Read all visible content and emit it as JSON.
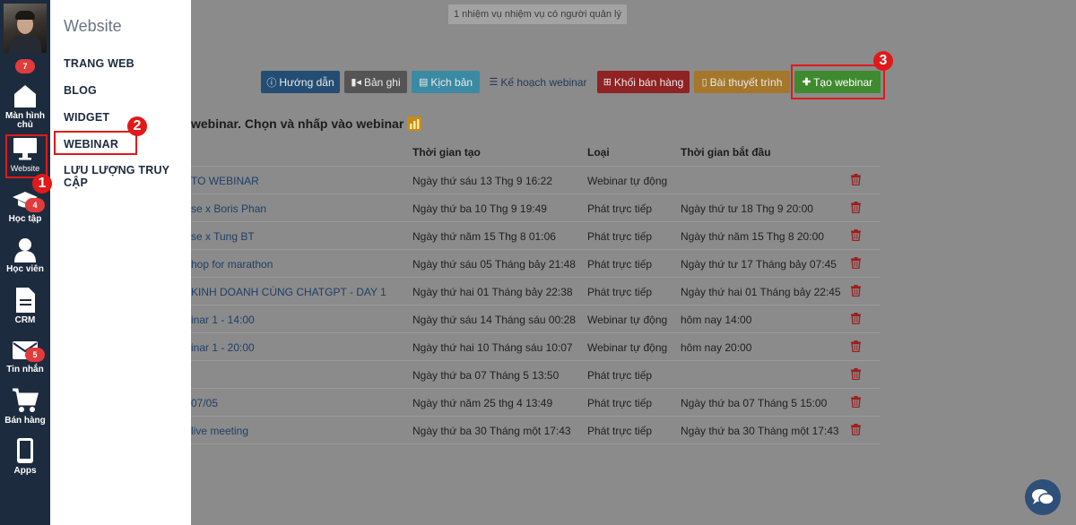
{
  "sidebar": {
    "avatar_badge": "7",
    "items": [
      {
        "label": "Màn hình chủ",
        "icon": "home-icon"
      },
      {
        "label": "Website",
        "icon": "monitor-icon"
      },
      {
        "label": "Học tập",
        "icon": "graduation-cap-icon",
        "badge": "4"
      },
      {
        "label": "Học viên",
        "icon": "user-icon"
      },
      {
        "label": "CRM",
        "icon": "document-icon"
      },
      {
        "label": "Tin nhắn",
        "icon": "mail-icon",
        "badge": "5"
      },
      {
        "label": "Bán hàng",
        "icon": "cart-icon"
      },
      {
        "label": "Apps",
        "icon": "phone-icon"
      }
    ]
  },
  "flyout": {
    "title": "Website",
    "items": [
      "TRANG WEB",
      "BLOG",
      "WIDGET",
      "WEBINAR",
      "LƯU LƯỢNG TRUY CẬP"
    ]
  },
  "notice": "1 nhiệm vụ nhiệm vụ có người quản lý",
  "toolbar": {
    "guide": "Hướng dẫn",
    "recording": "Bản ghi",
    "script": "Kịch bản",
    "plan": "Kế hoạch webinar",
    "sales_block": "Khối bán hàng",
    "presentation": "Bài thuyết trình",
    "create": "Tạo webinar"
  },
  "section_title": "webinar. Chọn và nhấp vào webinar",
  "table": {
    "headers": {
      "created": "Thời gian tạo",
      "type": "Loại",
      "start": "Thời gian bắt đầu"
    },
    "rows": [
      {
        "name": "TO WEBINAR",
        "created": "Ngày thứ sáu 13 Thg 9 16:22",
        "type": "Webinar tự động",
        "start": ""
      },
      {
        "name": "se x Boris Phan",
        "created": "Ngày thứ ba 10 Thg 9 19:49",
        "type": "Phát trực tiếp",
        "start": "Ngày thứ tư 18 Thg 9 20:00"
      },
      {
        "name": "se x Tung BT",
        "created": "Ngày thứ năm 15 Thg 8 01:06",
        "type": "Phát trực tiếp",
        "start": "Ngày thứ năm 15 Thg 8 20:00"
      },
      {
        "name": "hop for marathon",
        "created": "Ngày thứ sáu 05 Tháng bảy 21:48",
        "type": "Phát trực tiếp",
        "start": "Ngày thứ tư 17 Tháng bảy 07:45"
      },
      {
        "name": "KINH DOANH CÙNG CHATGPT - DAY 1",
        "created": "Ngày thứ hai 01 Tháng bảy 22:38",
        "type": "Phát trực tiếp",
        "start": "Ngày thứ hai 01 Tháng bảy 22:45"
      },
      {
        "name": "inar 1 - 14:00",
        "created": "Ngày thứ sáu 14 Tháng sáu 00:28",
        "type": "Webinar tự động",
        "start": "hôm nay 14:00"
      },
      {
        "name": "inar 1 - 20:00",
        "created": "Ngày thứ hai 10 Tháng sáu 10:07",
        "type": "Webinar tự động",
        "start": "hôm nay 20:00"
      },
      {
        "name": "",
        "created": "Ngày thứ ba 07 Tháng 5 13:50",
        "type": "Phát trực tiếp",
        "start": ""
      },
      {
        "name": "07/05",
        "created": "Ngày thứ năm 25 thg 4 13:49",
        "type": "Phát trực tiếp",
        "start": "Ngày thứ ba 07 Tháng 5 15:00"
      },
      {
        "name": "live meeting",
        "created": "Ngày thứ ba 30 Tháng một 17:43",
        "type": "Phát trực tiếp",
        "start": "Ngày thứ ba 30 Tháng một 17:43"
      }
    ]
  },
  "steps": [
    "1",
    "2",
    "3"
  ],
  "colors": {
    "sidebar": "#1d2b3e",
    "overlay": "#8b8b8b",
    "highlight": "#e11919",
    "create_button": "#3f8a2e"
  }
}
